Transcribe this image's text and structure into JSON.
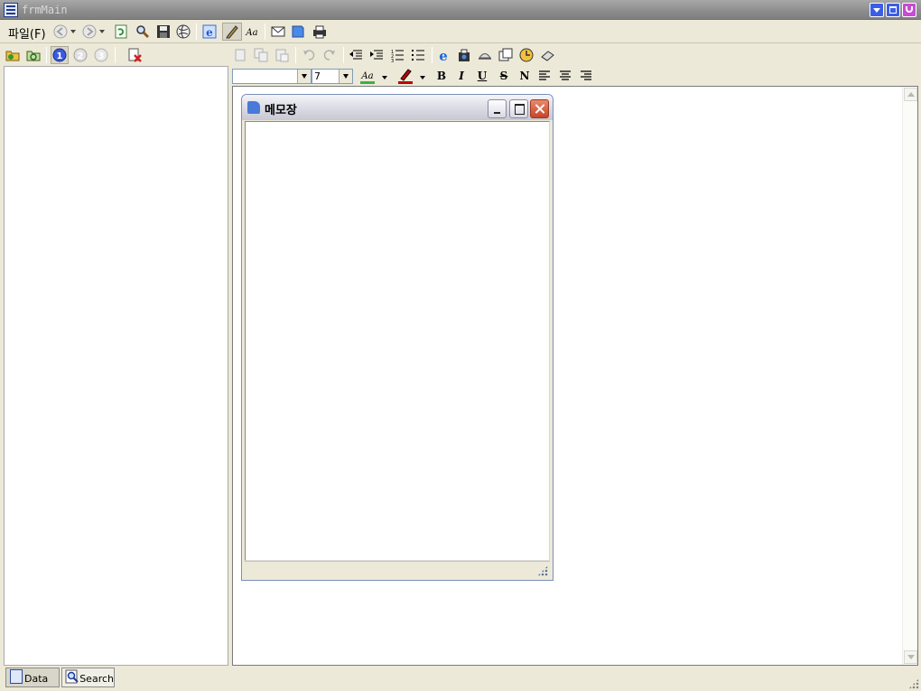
{
  "window": {
    "title": "frmMain"
  },
  "menu": {
    "file_label": "파일(F)"
  },
  "font": {
    "name_value": "",
    "size_value": "7"
  },
  "format": {
    "bold": "B",
    "italic": "I",
    "underline": "U",
    "strike": "S",
    "normal": "N"
  },
  "memo": {
    "title": "메모장",
    "text": ""
  },
  "tabs": {
    "data_label": "Data",
    "search_label": "Search"
  },
  "colors": {
    "titlebar": "#8c8c8c",
    "workspace": "#ece9d8",
    "font_color_bar": "#3cb043",
    "highlight_bar": "#c00000"
  }
}
